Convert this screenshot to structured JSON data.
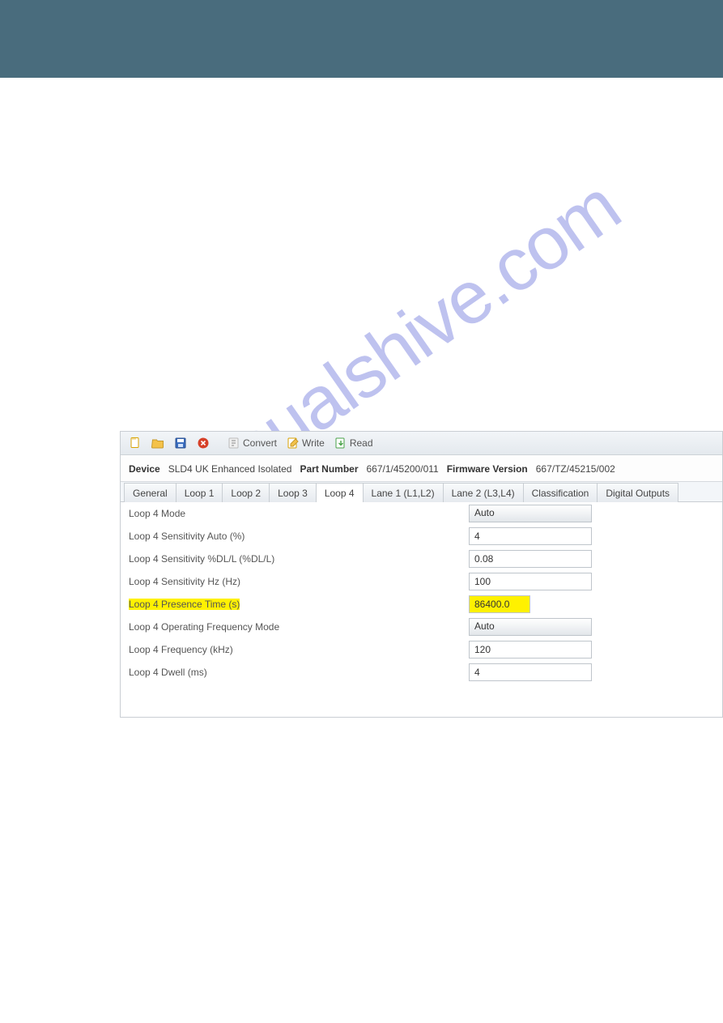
{
  "watermark_text": "manualshive.com",
  "toolbar": {
    "convert_label": "Convert",
    "write_label": "Write",
    "read_label": "Read"
  },
  "info": {
    "device_lbl": "Device",
    "device_val": "SLD4 UK Enhanced Isolated",
    "part_lbl": "Part Number",
    "part_val": "667/1/45200/011",
    "fw_lbl": "Firmware Version",
    "fw_val": "667/TZ/45215/002"
  },
  "tabs": [
    "General",
    "Loop 1",
    "Loop 2",
    "Loop 3",
    "Loop 4",
    "Lane 1 (L1,L2)",
    "Lane 2 (L3,L4)",
    "Classification",
    "Digital Outputs"
  ],
  "active_tab_index": 4,
  "form": {
    "rows": [
      {
        "label": "Loop 4 Mode",
        "value": "Auto",
        "type": "select",
        "highlight": false
      },
      {
        "label": "Loop 4 Sensitivity Auto (%)",
        "value": "4",
        "type": "text",
        "highlight": false
      },
      {
        "label": "Loop 4 Sensitivity %DL/L (%DL/L)",
        "value": "0.08",
        "type": "text",
        "highlight": false
      },
      {
        "label": "Loop 4 Sensitivity Hz (Hz)",
        "value": "100",
        "type": "text",
        "highlight": false
      },
      {
        "label": "Loop 4 Presence Time (s)",
        "value": "86400.0",
        "type": "text",
        "highlight": true
      },
      {
        "label": "Loop 4 Operating Frequency Mode",
        "value": "Auto",
        "type": "select",
        "highlight": false
      },
      {
        "label": "Loop 4 Frequency (kHz)",
        "value": "120",
        "type": "text",
        "highlight": false
      },
      {
        "label": "Loop 4 Dwell (ms)",
        "value": "4",
        "type": "text",
        "highlight": false
      }
    ]
  }
}
